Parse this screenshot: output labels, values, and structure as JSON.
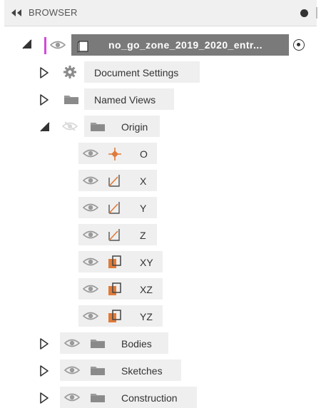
{
  "header": {
    "title": "BROWSER"
  },
  "tree": {
    "root": {
      "label": "no_go_zone_2019_2020_entr..."
    },
    "document_settings": {
      "label": "Document Settings"
    },
    "named_views": {
      "label": "Named Views"
    },
    "origin": {
      "label": "Origin",
      "children": [
        "O",
        "X",
        "Y",
        "Z",
        "XY",
        "XZ",
        "YZ"
      ]
    },
    "bodies": {
      "label": "Bodies"
    },
    "sketches": {
      "label": "Sketches"
    },
    "construction": {
      "label": "Construction"
    }
  },
  "colors": {
    "accent_orange": "#e07b39",
    "root_highlight": "#7a7a7a",
    "active_marker": "#d24ad9",
    "row_background": "#efefef"
  },
  "icons": {
    "collapse": "double-left-arrow-icon",
    "expand": "triangle-right-icon",
    "expanded": "triangle-down-icon",
    "visibility": "eye-icon",
    "hidden": "eye-slash-icon",
    "folder": "folder-icon",
    "document": "component-icon",
    "settings": "gear-icon",
    "origin_point": "origin-point-icon",
    "axis": "axis-icon",
    "plane": "plane-icon"
  }
}
